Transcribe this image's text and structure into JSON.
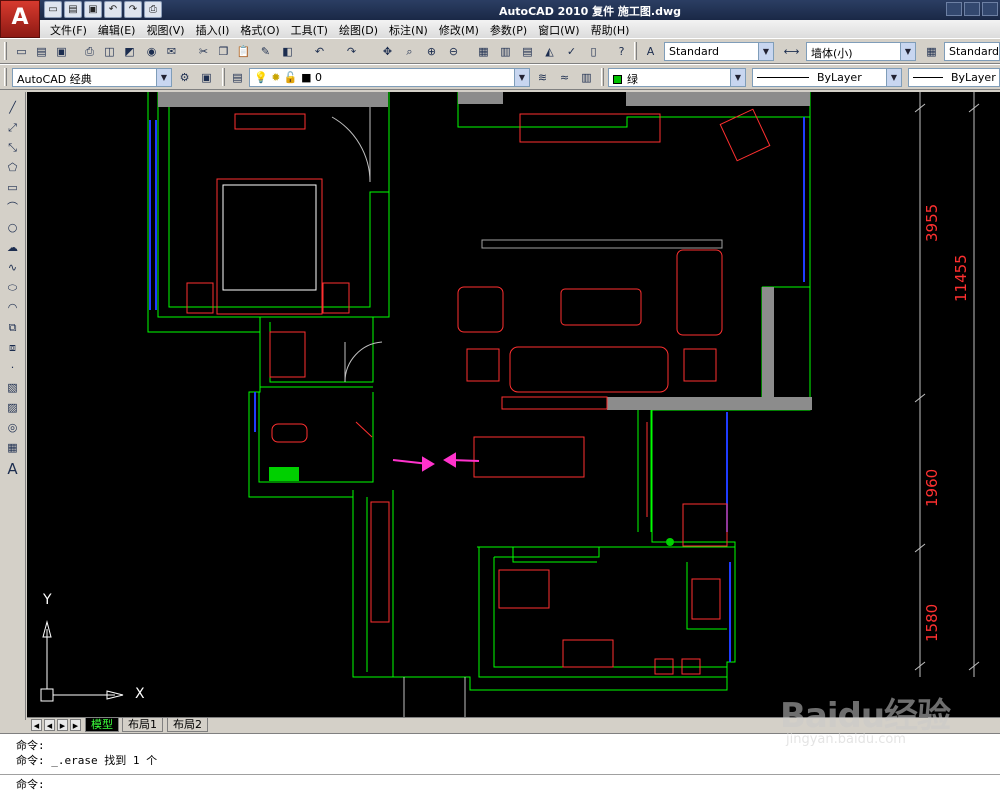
{
  "window": {
    "title": "AutoCAD 2010    复件 施工图.dwg",
    "app_logo": "A"
  },
  "quick_access": [
    "new-icon",
    "open-icon",
    "save-icon",
    "undo-icon",
    "redo-icon",
    "plot-icon"
  ],
  "menu": {
    "items": [
      "文件(F)",
      "编辑(E)",
      "视图(V)",
      "插入(I)",
      "格式(O)",
      "工具(T)",
      "绘图(D)",
      "标注(N)",
      "修改(M)",
      "参数(P)",
      "窗口(W)",
      "帮助(H)"
    ]
  },
  "toolbar": {
    "text_style": "Standard",
    "dim_style": "墙体(小)",
    "table_style": "Standard"
  },
  "properties_bar": {
    "workspace": "AutoCAD 经典",
    "layer": "0",
    "color": "绿",
    "linetype": "ByLayer",
    "lineweight": "ByLayer",
    "color_hex": "#00c000"
  },
  "drawing": {
    "dimensions": [
      "3955",
      "11455",
      "1960",
      "1580"
    ],
    "ucs_x": "X",
    "ucs_y": "Y",
    "wall_color": "#00ff00",
    "furniture_color": "#ff3030",
    "window_color": "#1f3cff",
    "arrow_color": "#ff33cc"
  },
  "tabs": [
    "模型",
    "布局1",
    "布局2"
  ],
  "command": {
    "lines": [
      "命令:",
      "命令: _.erase 找到 1 个"
    ],
    "prompt": "命令:"
  },
  "watermark": {
    "brand": "Baidu经验",
    "url": "jingyan.baidu.com"
  }
}
